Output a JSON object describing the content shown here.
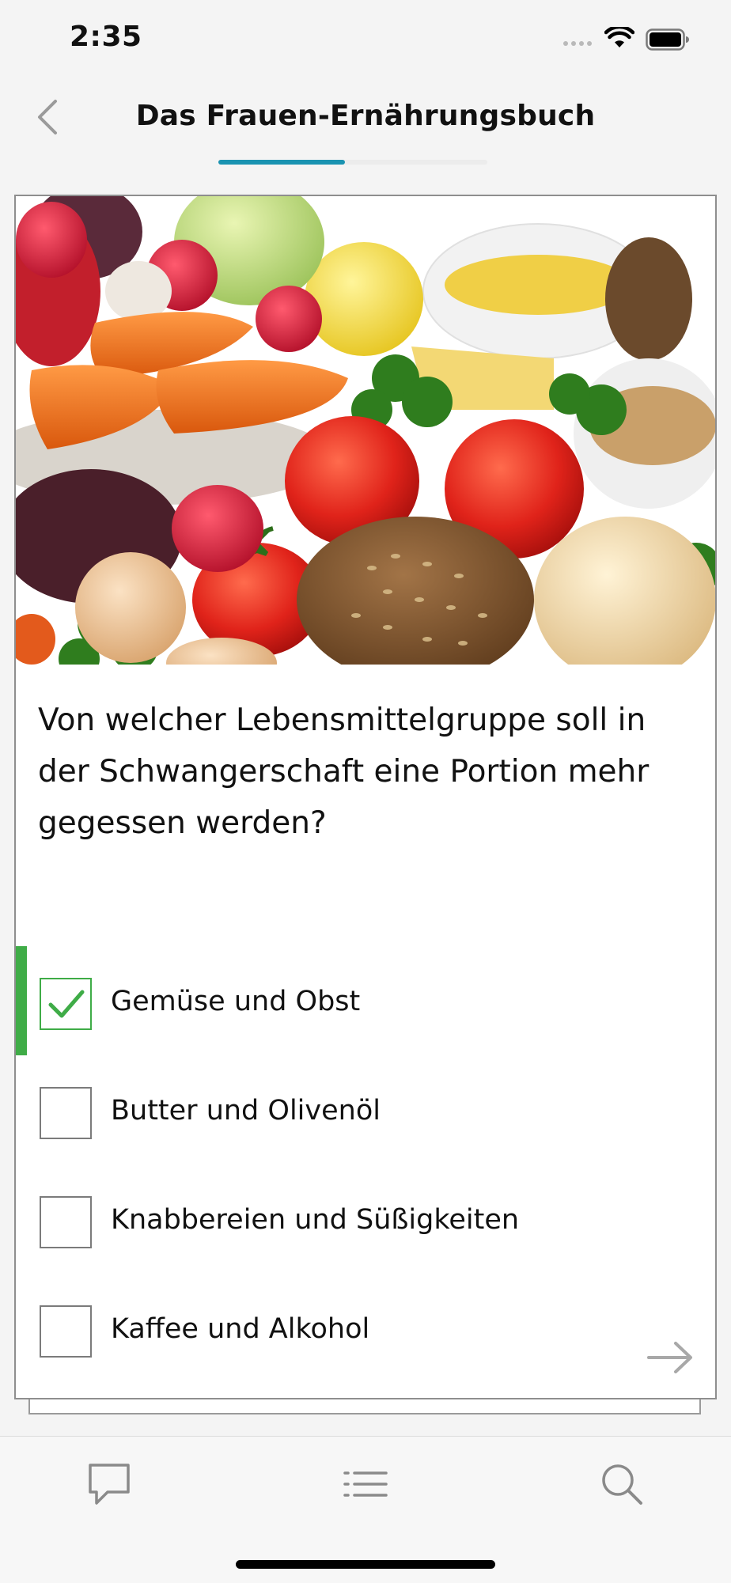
{
  "status_bar": {
    "time": "2:35"
  },
  "nav": {
    "title": "Das Frauen-Ernährungsbuch",
    "progress": 0.47
  },
  "quiz": {
    "question": "Von welcher Lebensmittelgruppe soll in der Schwangerschaft eine Portion mehr gegessen werden?",
    "options": [
      {
        "label": "Gemüse und Obst",
        "checked": true
      },
      {
        "label": "Butter und Olivenöl",
        "checked": false
      },
      {
        "label": "Knabbereien und Süßigkeiten",
        "checked": false
      },
      {
        "label": "Kaffee und Alkohol",
        "checked": false
      }
    ]
  },
  "icons": {
    "back": "chevron-left-icon",
    "next": "arrow-right-icon",
    "tabs": [
      "chat-bubble-icon",
      "list-icon",
      "search-icon"
    ]
  },
  "colors": {
    "accent": "#1a93b1",
    "correct": "#3fac47"
  }
}
